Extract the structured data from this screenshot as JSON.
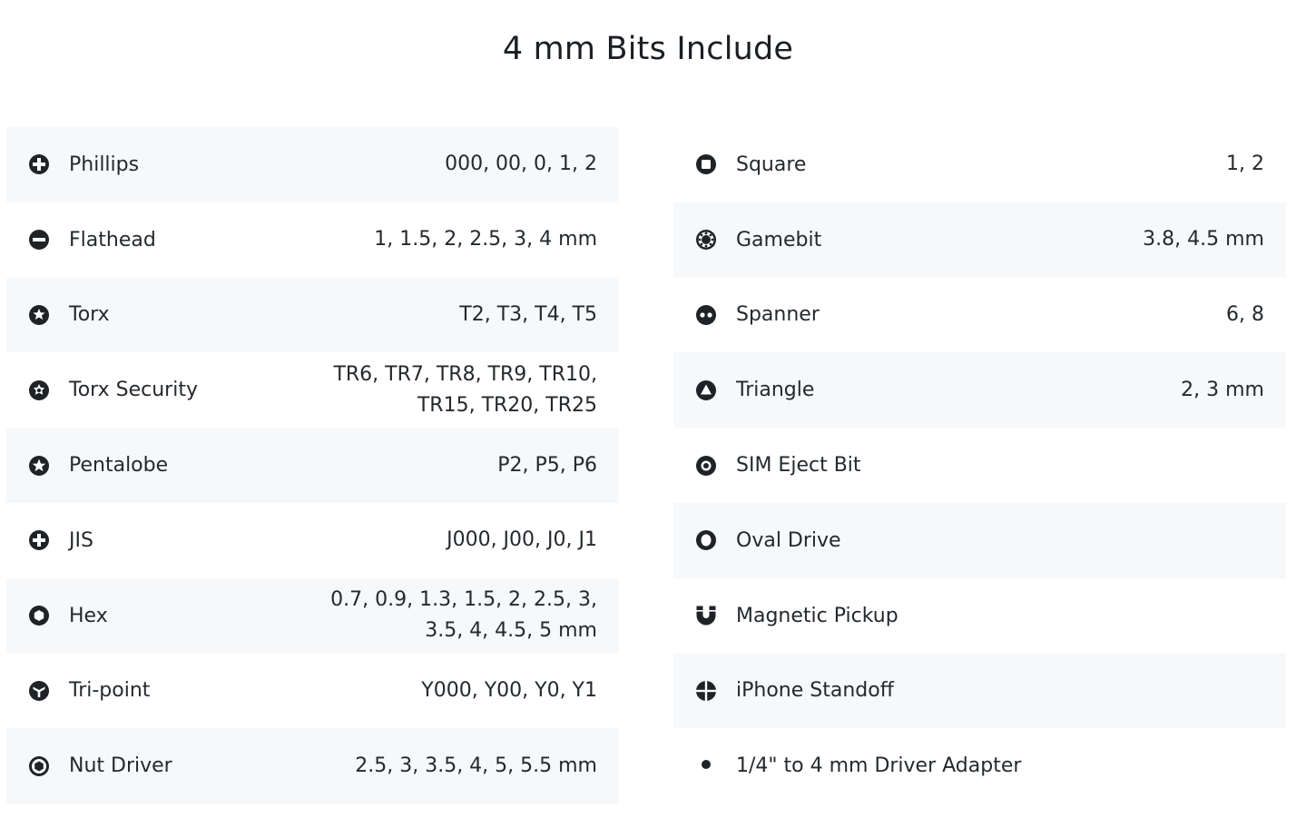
{
  "title": "4 mm Bits Include",
  "left": [
    {
      "icon": "phillips-icon",
      "label": "Phillips",
      "value": "000, 00, 0, 1, 2"
    },
    {
      "icon": "flathead-icon",
      "label": "Flathead",
      "value": "1, 1.5, 2, 2.5, 3, 4 mm"
    },
    {
      "icon": "torx-icon",
      "label": "Torx",
      "value": "T2, T3, T4, T5"
    },
    {
      "icon": "torx-security-icon",
      "label": "Torx Security",
      "value": "TR6, TR7, TR8, TR9, TR10, TR15, TR20, TR25"
    },
    {
      "icon": "pentalobe-icon",
      "label": "Pentalobe",
      "value": "P2, P5, P6"
    },
    {
      "icon": "jis-icon",
      "label": "JIS",
      "value": "J000, J00, J0, J1"
    },
    {
      "icon": "hex-icon",
      "label": "Hex",
      "value": "0.7, 0.9, 1.3, 1.5, 2, 2.5, 3, 3.5, 4, 4.5, 5 mm"
    },
    {
      "icon": "tri-point-icon",
      "label": "Tri-point",
      "value": "Y000, Y00, Y0, Y1"
    },
    {
      "icon": "nut-driver-icon",
      "label": "Nut Driver",
      "value": "2.5, 3, 3.5, 4, 5, 5.5 mm"
    }
  ],
  "right": [
    {
      "icon": "square-icon",
      "label": "Square",
      "value": "1, 2"
    },
    {
      "icon": "gamebit-icon",
      "label": "Gamebit",
      "value": "3.8, 4.5 mm"
    },
    {
      "icon": "spanner-icon",
      "label": "Spanner",
      "value": "6, 8"
    },
    {
      "icon": "triangle-icon",
      "label": "Triangle",
      "value": "2, 3 mm"
    },
    {
      "icon": "sim-eject-icon",
      "label": "SIM Eject Bit",
      "value": ""
    },
    {
      "icon": "oval-drive-icon",
      "label": "Oval Drive",
      "value": ""
    },
    {
      "icon": "magnetic-pickup-icon",
      "label": "Magnetic Pickup",
      "value": ""
    },
    {
      "icon": "iphone-standoff-icon",
      "label": "iPhone Standoff",
      "value": ""
    },
    {
      "icon": "driver-adapter-icon",
      "label": "1/4\" to 4 mm Driver Adapter",
      "value": ""
    }
  ]
}
